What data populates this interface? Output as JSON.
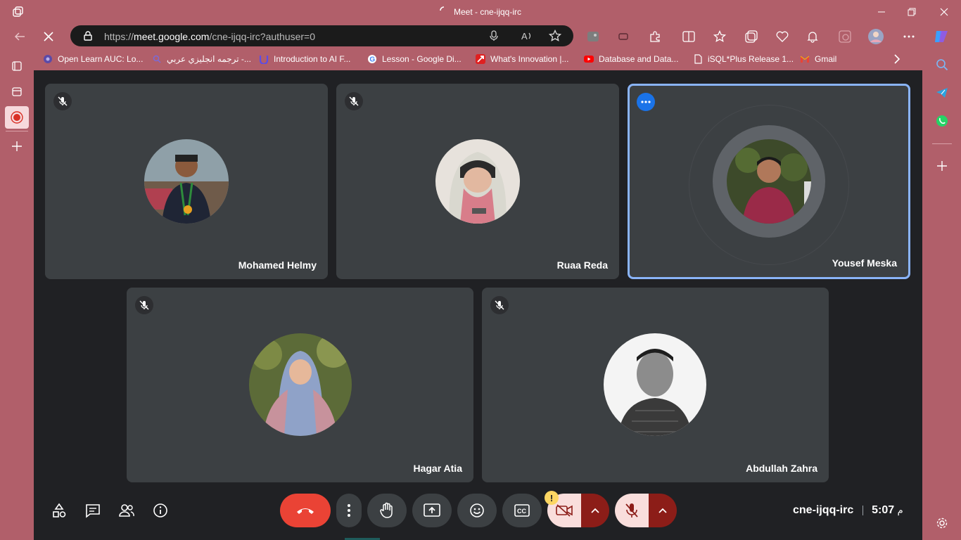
{
  "window": {
    "title": "Meet - cne-ijqq-irc"
  },
  "address_bar": {
    "url_prefix": "https://",
    "url_host": "meet.google.com",
    "url_path": "/cne-ijqq-irc?authuser=0"
  },
  "favorites": [
    {
      "label": "Open Learn AUC: Lo...",
      "icon": "open-learn-icon"
    },
    {
      "label": "ترجمه انجليزي عربي -...",
      "icon": "search-icon"
    },
    {
      "label": "Introduction to AI F...",
      "icon": "udacity-icon"
    },
    {
      "label": "Lesson - Google Di...",
      "icon": "google-icon"
    },
    {
      "label": "What's Innovation |...",
      "icon": "innovation-icon"
    },
    {
      "label": "Database and Data...",
      "icon": "youtube-icon"
    },
    {
      "label": "iSQL*Plus Release 1...",
      "icon": "document-icon"
    },
    {
      "label": "Gmail",
      "icon": "gmail-icon"
    }
  ],
  "participants": [
    {
      "name": "Mohamed Helmy",
      "muted": true,
      "avatar": "photo"
    },
    {
      "name": "Ruaa Reda",
      "muted": true,
      "avatar": "photo"
    },
    {
      "name": "Yousef Meska",
      "muted": false,
      "avatar": "photo",
      "active": true
    },
    {
      "name": "Hagar Atia",
      "muted": true,
      "avatar": "photo"
    },
    {
      "name": "Abdullah Zahra",
      "muted": true,
      "avatar": "photo"
    }
  ],
  "meeting": {
    "code": "cne-ijqq-irc",
    "time": "5:07",
    "period": "م"
  },
  "colors": {
    "browser_frame": "#b15f6a",
    "meet_background": "#202124",
    "tile": "#3c4043",
    "end_call": "#ea4335",
    "active_border": "#8ab4f8",
    "camera_off": "#f9dedc",
    "warning": "#fdd663"
  }
}
